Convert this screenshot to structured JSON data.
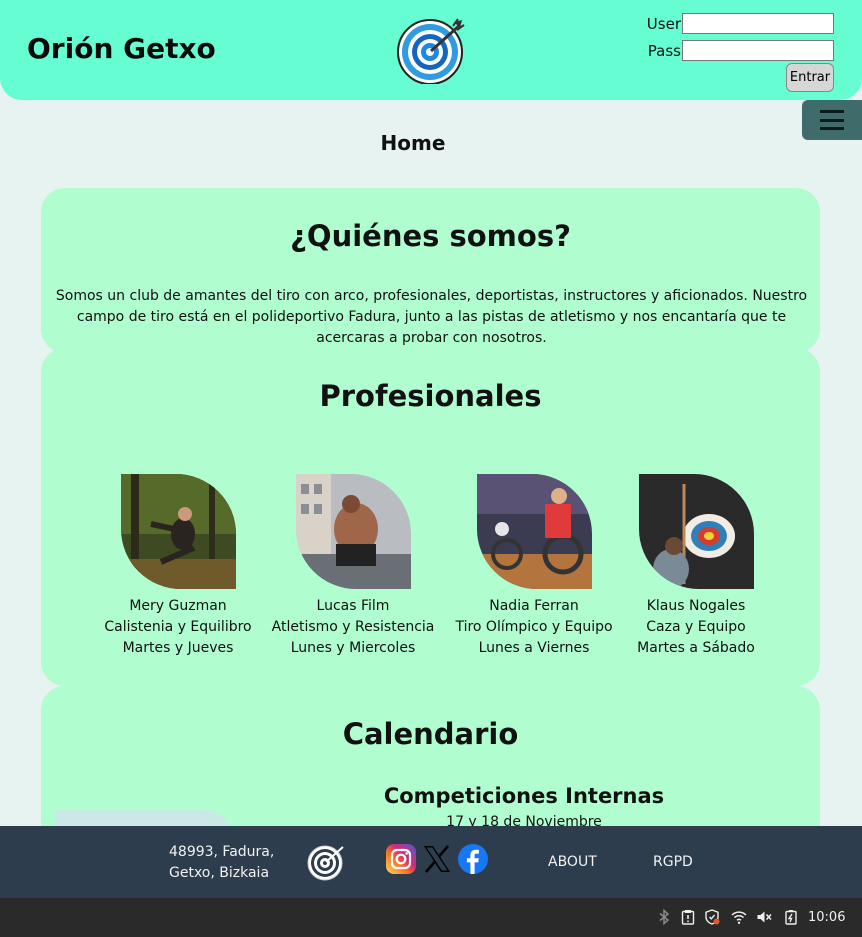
{
  "header": {
    "site_title": "Orión Getxo",
    "login": {
      "user_label": "User",
      "pass_label": "Pass",
      "user_value": "",
      "pass_value": "",
      "submit_label": "Entrar"
    },
    "menu_icon": "hamburger-icon"
  },
  "page_heading": "Home",
  "about": {
    "title": "¿Quiénes somos?",
    "text": "Somos un club de amantes del tiro con arco, profesionales, deportistas, instructores y aficionados. Nuestro campo de tiro está en el polideportivo Fadura, junto a las pistas de atletismo y nos encantaría que te acercaras a probar con nosotros."
  },
  "professionals": {
    "title": "Profesionales",
    "items": [
      {
        "name": "Mery Guzman",
        "specialty": "Calistenia y Equilibro",
        "schedule": "Martes y Jueves"
      },
      {
        "name": "Lucas Film",
        "specialty": "Atletismo y Resistencia",
        "schedule": "Lunes y Miercoles"
      },
      {
        "name": "Nadia Ferran",
        "specialty": "Tiro Olímpico y Equipo",
        "schedule": "Lunes a Viernes"
      },
      {
        "name": "Klaus Nogales",
        "specialty": "Caza y Equipo",
        "schedule": "Martes a Sábado"
      }
    ]
  },
  "calendar": {
    "title": "Calendario",
    "event_title": "Competiciones Internas",
    "event_date": "17 y 18 de Noviembre"
  },
  "footer": {
    "address_line1": "48993, Fadura,",
    "address_line2": "Getxo, Bizkaia",
    "social_icons": [
      "instagram-icon",
      "x-icon",
      "facebook-icon"
    ],
    "links": [
      "ABOUT",
      "RGPD"
    ]
  },
  "taskbar": {
    "tray_icons": [
      "bluetooth-icon",
      "clipboard-icon",
      "shield-icon",
      "wifi-icon",
      "volume-muted-icon",
      "battery-icon"
    ],
    "clock": "10:06"
  },
  "colors": {
    "header_bg": "#66fdd2",
    "card_bg": "#b0fdd0",
    "page_bg": "#e6f3f1",
    "footer_bg": "#2d3d4d",
    "menu_bg": "#3f6b6a"
  }
}
